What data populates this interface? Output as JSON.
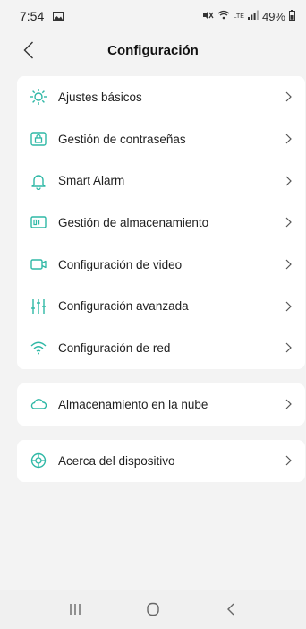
{
  "status": {
    "time": "7:54",
    "battery": "49%",
    "network": "LTE"
  },
  "header": {
    "title": "Configuración"
  },
  "menu": {
    "main": [
      {
        "label": "Ajustes básicos",
        "icon": "sun-gear-icon"
      },
      {
        "label": "Gestión de contraseñas",
        "icon": "lock-icon"
      },
      {
        "label": "Smart Alarm",
        "icon": "bell-icon"
      },
      {
        "label": "Gestión de almacenamiento",
        "icon": "storage-icon"
      },
      {
        "label": "Configuración de video",
        "icon": "video-icon"
      },
      {
        "label": "Configuración avanzada",
        "icon": "sliders-icon"
      },
      {
        "label": "Configuración de red",
        "icon": "wifi-icon"
      }
    ],
    "cloud": {
      "label": "Almacenamiento en la nube",
      "icon": "cloud-icon"
    },
    "about": {
      "label": "Acerca del dispositivo",
      "icon": "info-gear-icon"
    }
  },
  "colors": {
    "accent": "#2fb8a6",
    "background": "#f3f3f3",
    "card": "#ffffff"
  }
}
